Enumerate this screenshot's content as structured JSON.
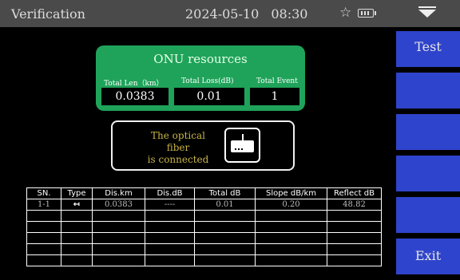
{
  "topbar": {
    "title": "Verification",
    "date": "2024-05-10",
    "time": "08:30",
    "usb_icon": "usb-icon",
    "battery_icon": "battery-icon",
    "menu_icon": "dropdown-menu-icon"
  },
  "sidebar": {
    "buttons": [
      {
        "label": "Test"
      },
      {
        "label": ""
      },
      {
        "label": ""
      },
      {
        "label": ""
      },
      {
        "label": ""
      },
      {
        "label": "Exit"
      }
    ]
  },
  "onu": {
    "title": "ONU resources",
    "total_len_label": "Total Len（km）",
    "total_loss_label": "Total Loss(dB)",
    "total_event_label": "Total Event",
    "total_len": "0.0383",
    "total_loss": "0.01",
    "total_event": "1"
  },
  "status": {
    "line1": "The optical fiber",
    "line2": "is connected",
    "icon": "router-icon"
  },
  "table": {
    "headers": [
      "SN.",
      "Type",
      "Dis.km",
      "Dis.dB",
      "Total dB",
      "Slope dB/km",
      "Reflect dB"
    ],
    "rows": [
      [
        "1-1",
        "↤",
        "0.0383",
        "----",
        "0.01",
        "0.20",
        "48.82"
      ],
      [
        "",
        "",
        "",
        "",
        "",
        "",
        ""
      ],
      [
        "",
        "",
        "",
        "",
        "",
        "",
        ""
      ],
      [
        "",
        "",
        "",
        "",
        "",
        "",
        ""
      ],
      [
        "",
        "",
        "",
        "",
        "",
        "",
        ""
      ],
      [
        "",
        "",
        "",
        "",
        "",
        "",
        ""
      ]
    ]
  },
  "colors": {
    "accent_blue": "#2f44cc",
    "onu_green": "#1fa35a",
    "status_text": "#c8b448",
    "topbar": "#4a4a4a"
  }
}
